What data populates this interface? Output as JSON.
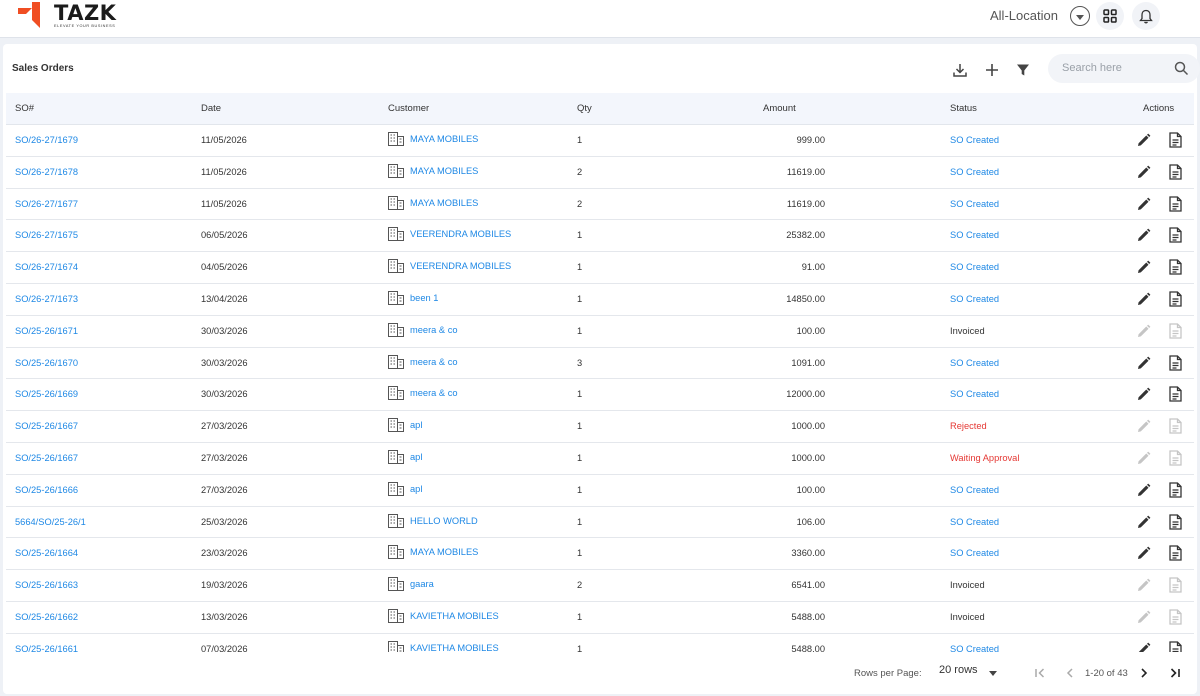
{
  "brand": {
    "name": "TAZK",
    "tagline": "ELEVATE YOUR BUSINESS",
    "accent": "#f04e23"
  },
  "header": {
    "location": "All-Location",
    "location_dropdown_icon": "chevron-down-circle-icon",
    "apps_icon": "grid-icon",
    "notifications_icon": "bell-icon"
  },
  "page": {
    "title": "Sales Orders",
    "toolbar": {
      "download_icon": "download-icon",
      "add_icon": "plus-icon",
      "filter_icon": "filter-icon"
    },
    "search": {
      "placeholder": "Search here",
      "value": ""
    }
  },
  "table": {
    "columns": [
      "SO#",
      "Date",
      "Customer",
      "Qty",
      "Amount",
      "Status",
      "Actions"
    ],
    "rows": [
      {
        "so": "SO/26-27/1679",
        "date": "11/05/2026",
        "customer": "MAYA MOBILES",
        "qty": "1",
        "amount": "999.00",
        "status": "SO Created",
        "status_type": "blue",
        "actions_enabled": true
      },
      {
        "so": "SO/26-27/1678",
        "date": "11/05/2026",
        "customer": "MAYA MOBILES",
        "qty": "2",
        "amount": "11619.00",
        "status": "SO Created",
        "status_type": "blue",
        "actions_enabled": true
      },
      {
        "so": "SO/26-27/1677",
        "date": "11/05/2026",
        "customer": "MAYA MOBILES",
        "qty": "2",
        "amount": "11619.00",
        "status": "SO Created",
        "status_type": "blue",
        "actions_enabled": true
      },
      {
        "so": "SO/26-27/1675",
        "date": "06/05/2026",
        "customer": "VEERENDRA MOBILES",
        "qty": "1",
        "amount": "25382.00",
        "status": "SO Created",
        "status_type": "blue",
        "actions_enabled": true
      },
      {
        "so": "SO/26-27/1674",
        "date": "04/05/2026",
        "customer": "VEERENDRA MOBILES",
        "qty": "1",
        "amount": "91.00",
        "status": "SO Created",
        "status_type": "blue",
        "actions_enabled": true
      },
      {
        "so": "SO/26-27/1673",
        "date": "13/04/2026",
        "customer": "been 1",
        "qty": "1",
        "amount": "14850.00",
        "status": "SO Created",
        "status_type": "blue",
        "actions_enabled": true
      },
      {
        "so": "SO/25-26/1671",
        "date": "30/03/2026",
        "customer": "meera & co",
        "qty": "1",
        "amount": "100.00",
        "status": "Invoiced",
        "status_type": "dark",
        "actions_enabled": false
      },
      {
        "so": "SO/25-26/1670",
        "date": "30/03/2026",
        "customer": "meera & co",
        "qty": "3",
        "amount": "1091.00",
        "status": "SO Created",
        "status_type": "blue",
        "actions_enabled": true
      },
      {
        "so": "SO/25-26/1669",
        "date": "30/03/2026",
        "customer": "meera & co",
        "qty": "1",
        "amount": "12000.00",
        "status": "SO Created",
        "status_type": "blue",
        "actions_enabled": true
      },
      {
        "so": "SO/25-26/1667",
        "date": "27/03/2026",
        "customer": "apl",
        "qty": "1",
        "amount": "1000.00",
        "status": "Rejected",
        "status_type": "red",
        "actions_enabled": false
      },
      {
        "so": "SO/25-26/1667",
        "date": "27/03/2026",
        "customer": "apl",
        "qty": "1",
        "amount": "1000.00",
        "status": "Waiting Approval",
        "status_type": "red",
        "actions_enabled": false
      },
      {
        "so": "SO/25-26/1666",
        "date": "27/03/2026",
        "customer": "apl",
        "qty": "1",
        "amount": "100.00",
        "status": "SO Created",
        "status_type": "blue",
        "actions_enabled": true
      },
      {
        "so": "5664/SO/25-26/1",
        "date": "25/03/2026",
        "customer": "HELLO WORLD",
        "qty": "1",
        "amount": "106.00",
        "status": "SO Created",
        "status_type": "blue",
        "actions_enabled": true
      },
      {
        "so": "SO/25-26/1664",
        "date": "23/03/2026",
        "customer": "MAYA MOBILES",
        "qty": "1",
        "amount": "3360.00",
        "status": "SO Created",
        "status_type": "blue",
        "actions_enabled": true
      },
      {
        "so": "SO/25-26/1663",
        "date": "19/03/2026",
        "customer": "gaara",
        "qty": "2",
        "amount": "6541.00",
        "status": "Invoiced",
        "status_type": "dark",
        "actions_enabled": false
      },
      {
        "so": "SO/25-26/1662",
        "date": "13/03/2026",
        "customer": "KAVIETHA MOBILES",
        "qty": "1",
        "amount": "5488.00",
        "status": "Invoiced",
        "status_type": "dark",
        "actions_enabled": false
      },
      {
        "so": "SO/25-26/1661",
        "date": "07/03/2026",
        "customer": "KAVIETHA MOBILES",
        "qty": "1",
        "amount": "5488.00",
        "status": "SO Created",
        "status_type": "blue",
        "actions_enabled": true
      }
    ],
    "row_icons": {
      "customer_icon": "building-icon",
      "edit_icon": "pencil-icon",
      "doc_icon": "document-icon"
    }
  },
  "pagination": {
    "rows_per_page_label": "Rows per Page:",
    "rows_per_page_value": "20 rows",
    "range": "1-20 of 43",
    "first_icon": "first-page-icon",
    "prev_icon": "chevron-left-icon",
    "next_icon": "chevron-right-icon",
    "last_icon": "last-page-icon"
  },
  "colors": {
    "link": "#1e88e5",
    "danger": "#e53935",
    "header_bg": "#f3f6fc",
    "page_bg": "#eef1f6"
  }
}
